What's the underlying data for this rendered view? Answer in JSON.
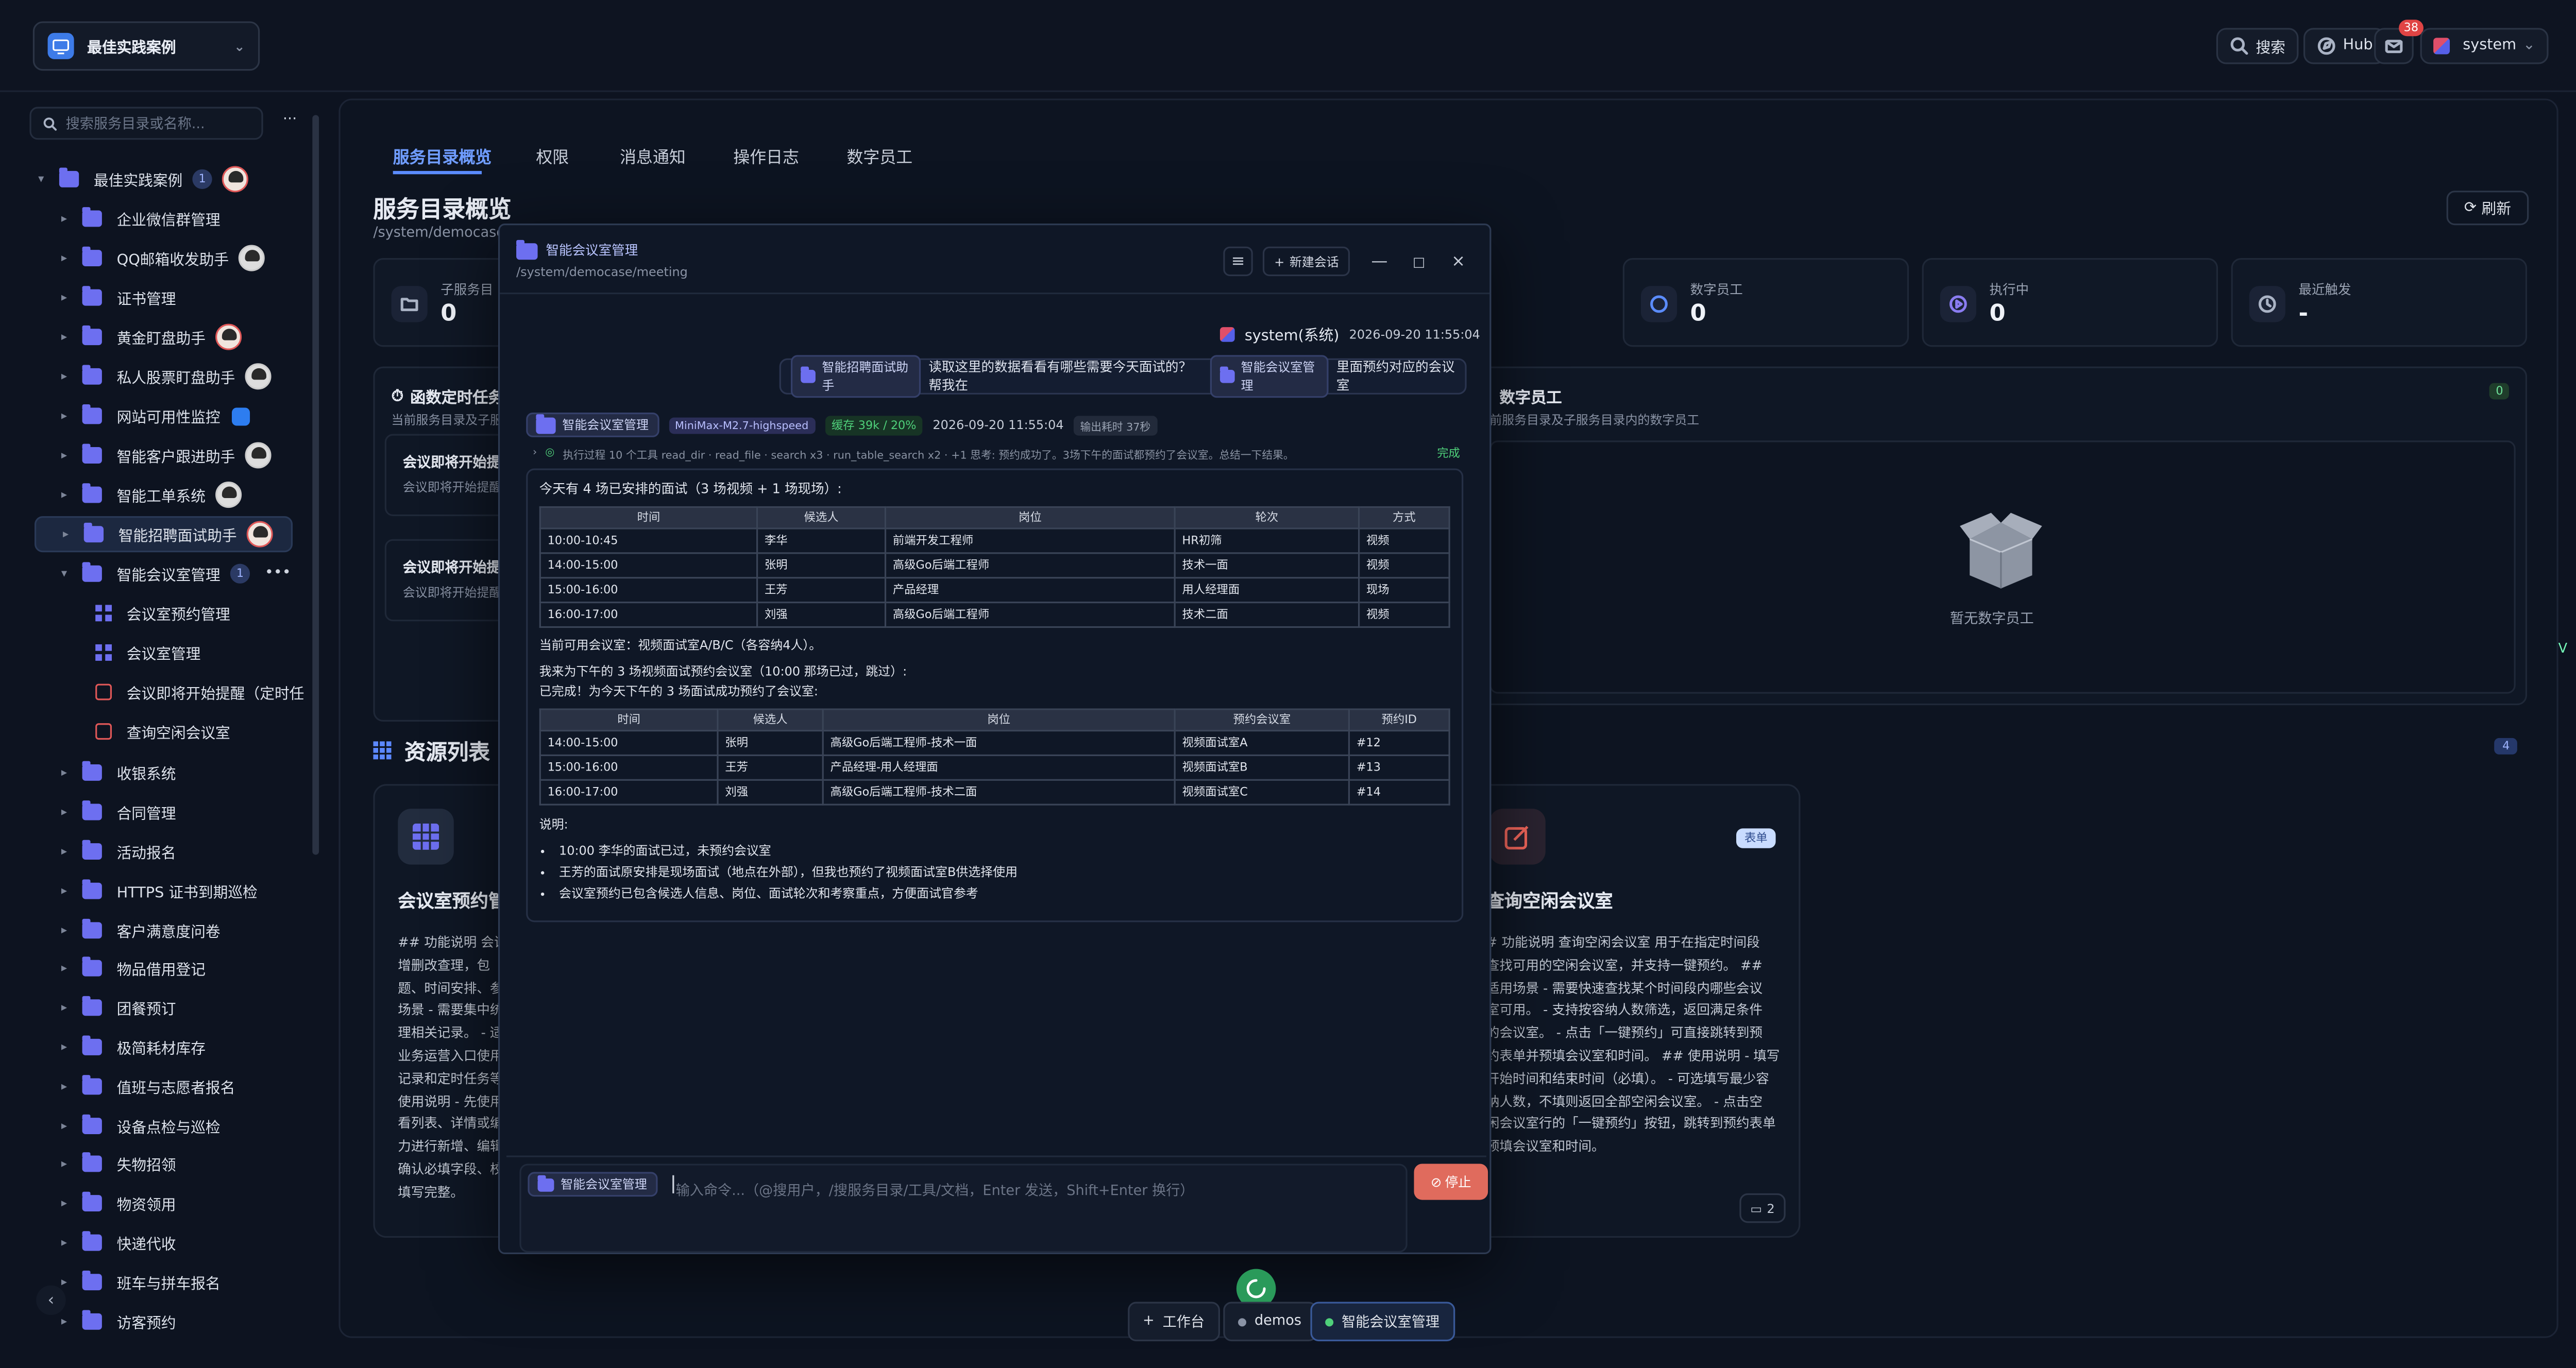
{
  "topbar": {
    "workspace": "最佳实践案例",
    "search": "搜索",
    "hub": "Hub",
    "mail_count": "38",
    "user": "system"
  },
  "sidebar": {
    "search_placeholder": "搜索服务目录或名称...",
    "more": "···",
    "root": {
      "label": "最佳实践案例",
      "count": "1"
    },
    "items": [
      {
        "label": "企业微信群管理"
      },
      {
        "label": "QQ邮箱收发助手"
      },
      {
        "label": "证书管理"
      },
      {
        "label": "黄金盯盘助手"
      },
      {
        "label": "私人股票盯盘助手"
      },
      {
        "label": "网站可用性监控"
      },
      {
        "label": "智能客户跟进助手"
      },
      {
        "label": "智能工单系统"
      },
      {
        "label": "智能招聘面试助手"
      }
    ],
    "open_item": {
      "label": "智能会议室管理",
      "count": "1"
    },
    "children": [
      {
        "label": "会议室预约管理"
      },
      {
        "label": "会议室管理"
      },
      {
        "label": "会议即将开始提醒（定时任"
      },
      {
        "label": "查询空闲会议室"
      }
    ],
    "items_after": [
      {
        "label": "收银系统"
      },
      {
        "label": "合同管理"
      },
      {
        "label": "活动报名"
      },
      {
        "label": "HTTPS 证书到期巡检"
      },
      {
        "label": "客户满意度问卷"
      },
      {
        "label": "物品借用登记"
      },
      {
        "label": "团餐预订"
      },
      {
        "label": "极简耗材库存"
      },
      {
        "label": "值班与志愿者报名"
      },
      {
        "label": "设备点检与巡检"
      },
      {
        "label": "失物招领"
      },
      {
        "label": "物资领用"
      },
      {
        "label": "快递代收"
      },
      {
        "label": "班车与拼车报名"
      },
      {
        "label": "访客预约"
      }
    ]
  },
  "main": {
    "tabs": [
      "服务目录概览",
      "权限",
      "消息通知",
      "操作日志",
      "数字员工"
    ],
    "title": "服务目录概览",
    "path": "/system/democase/",
    "refresh": "刷新",
    "stats": [
      {
        "label": "子服务目",
        "value": "0"
      },
      {
        "label": "数字员工",
        "value": "0"
      },
      {
        "label": "执行中",
        "value": "0"
      },
      {
        "label": "最近触发",
        "value": "-"
      }
    ],
    "timer_panel": {
      "title": "函数定时任务",
      "subtitle": "当前服务目录及子服",
      "entries": [
        {
          "title": "会议即将开始提",
          "desc": "会议即将开始提醒"
        },
        {
          "title": "会议即将开始提",
          "desc": "会议即将开始提醒"
        }
      ]
    },
    "staff_panel": {
      "title": "数字员工",
      "subtitle": "前服务目录及子服务目录内的数字员工",
      "count": "0",
      "empty": "暂无数字员工"
    },
    "resources": {
      "title": "资源列表",
      "count": "4",
      "card_left": {
        "title": "会议室预约管",
        "desc": "## 功能说明 会议\n增删改查理，包\n题、时间安排、参\n场景 - 需要集中统\n理相关记录。 - 适\n业务运营入口使用\n记录和定时任务等\n使用说明 - 先使用\n看列表、详情或编\n力进行新增、编辑\n确认必填字段、校\n填写完整。"
      },
      "card_right": {
        "badge": "表单",
        "title": "查询空闲会议室",
        "desc": "# 功能说明 查询空闲会议室 用于在指定时间段\n查找可用的空闲会议室，并支持一键预约。 ##\n适用场景 - 需要快速查找某个时间段内哪些会议\n室可用。 - 支持按容纳人数筛选，返回满足条件\n的会议室。 - 点击「一键预约」可直接跳转到预\n约表单并预填会议室和时间。 ## 使用说明 - 填写\n开始时间和结束时间（必填）。 - 可选填写最少容\n纳人数，不填则返回全部空闲会议室。 - 点击空\n闲会议室行的「一键预约」按钮，跳转到预约表单\n预填会议室和时间。",
        "comments": "2"
      }
    }
  },
  "modal": {
    "title": "智能会议室管理",
    "path": "/system/democase/meeting",
    "new_chat": "新建会话",
    "user_name": "system(系统)",
    "user_time": "2026-09-20 11:55:04",
    "user_msg_chip": "智能招聘面试助手",
    "user_msg_text": "读取这里的数据看看有哪些需要今天面试的？帮我在",
    "user_msg_chip2": "智能会议室管理",
    "user_msg_tail": "里面预约对应的会议室",
    "bot_chip": "智能会议室管理",
    "model": "MiniMax-M2.7-highspeed",
    "cache": "缓存 39k / 20%",
    "bot_time": "2026-09-20 11:55:04",
    "duration": "输出耗时 37秒",
    "exec_text": "执行过程 10 个工具  read_dir · read_file · search x3 · run_table_search x2 · +1  思考: 预约成功了。3场下午的面试都预约了会议室。总结一下结果。",
    "exec_done": "完成",
    "answer_intro": "今天有 4 场已安排的面试（3 场视频 + 1 场现场）:",
    "table1": {
      "headers": [
        "时间",
        "候选人",
        "岗位",
        "轮次",
        "方式"
      ],
      "rows": [
        [
          "10:00-10:45",
          "李华",
          "前端开发工程师",
          "HR初筛",
          "视频"
        ],
        [
          "14:00-15:00",
          "张明",
          "高级Go后端工程师",
          "技术一面",
          "视频"
        ],
        [
          "15:00-16:00",
          "王芳",
          "产品经理",
          "用人经理面",
          "现场"
        ],
        [
          "16:00-17:00",
          "刘强",
          "高级Go后端工程师",
          "技术二面",
          "视频"
        ]
      ]
    },
    "avail_rooms": "当前可用会议室：视频面试室A/B/C（各容纳4人）。",
    "plan_line": "我来为下午的 3 场视频面试预约会议室（10:00 那场已过，跳过）:",
    "done_line": "已完成！为今天下午的 3 场面试成功预约了会议室:",
    "table2": {
      "headers": [
        "时间",
        "候选人",
        "岗位",
        "预约会议室",
        "预约ID"
      ],
      "rows": [
        [
          "14:00-15:00",
          "张明",
          "高级Go后端工程师-技术一面",
          "视频面试室A",
          "#12"
        ],
        [
          "15:00-16:00",
          "王芳",
          "产品经理-用人经理面",
          "视频面试室B",
          "#13"
        ],
        [
          "16:00-17:00",
          "刘强",
          "高级Go后端工程师-技术二面",
          "视频面试室C",
          "#14"
        ]
      ]
    },
    "notes_title": "说明:",
    "notes": [
      "10:00 李华的面试已过，未预约会议室",
      "王芳的面试原安排是现场面试（地点在外部），但我也预约了视频面试室B供选择使用",
      "会议室预约已包含候选人信息、岗位、面试轮次和考察重点，方便面试官参考"
    ],
    "input_chip": "智能会议室管理",
    "input_placeholder": "输入命令...（@搜用户，/搜服务目录/工具/文档，Enter 发送，Shift+Enter 换行）",
    "stop": "停止"
  },
  "dock": {
    "workbench": "工作台",
    "demos": "demos",
    "current": "智能会议室管理"
  },
  "colors": {
    "accent": "#5b8cff",
    "folder": "#6d6ff0",
    "stop": "#e06b5d",
    "success": "#4fd07a"
  }
}
